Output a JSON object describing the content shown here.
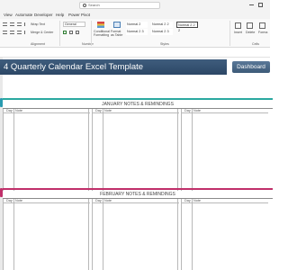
{
  "search": {
    "placeholder": "Search"
  },
  "ribbon_tabs": [
    "View",
    "Automate",
    "Developer",
    "Help",
    "Power Pivot"
  ],
  "ribbon": {
    "wrap_text": "Wrap Text",
    "merge_center": "Merge & Center",
    "font_value": "General",
    "conditional_formatting": "Conditional Formatting",
    "format_as_table": "Format as Table",
    "styles": [
      "Normal 2",
      "Normal 2 2",
      "Normal 2 2 2",
      "Normal 2 3",
      "Normal 2 3"
    ],
    "insert": "Insert",
    "delete": "Delete",
    "format": "Forma",
    "group_alignment": "Alignment",
    "group_number": "Number",
    "group_styles": "Styles",
    "group_cells": "Cells"
  },
  "banner": {
    "title": "4 Quarterly Calendar Excel Template",
    "dashboard_button": "Dashboard"
  },
  "sections": [
    {
      "header": "JANUARY NOTES & REMINDINGS",
      "accent": "#2aa9a0",
      "marker": "#2a9bb0"
    },
    {
      "header": "FEBRUARY NOTES & REMINDINGS",
      "accent": "#c0306a",
      "marker": "#c0306a"
    }
  ],
  "columns": {
    "day_label": "Day",
    "note_label": "Note"
  }
}
